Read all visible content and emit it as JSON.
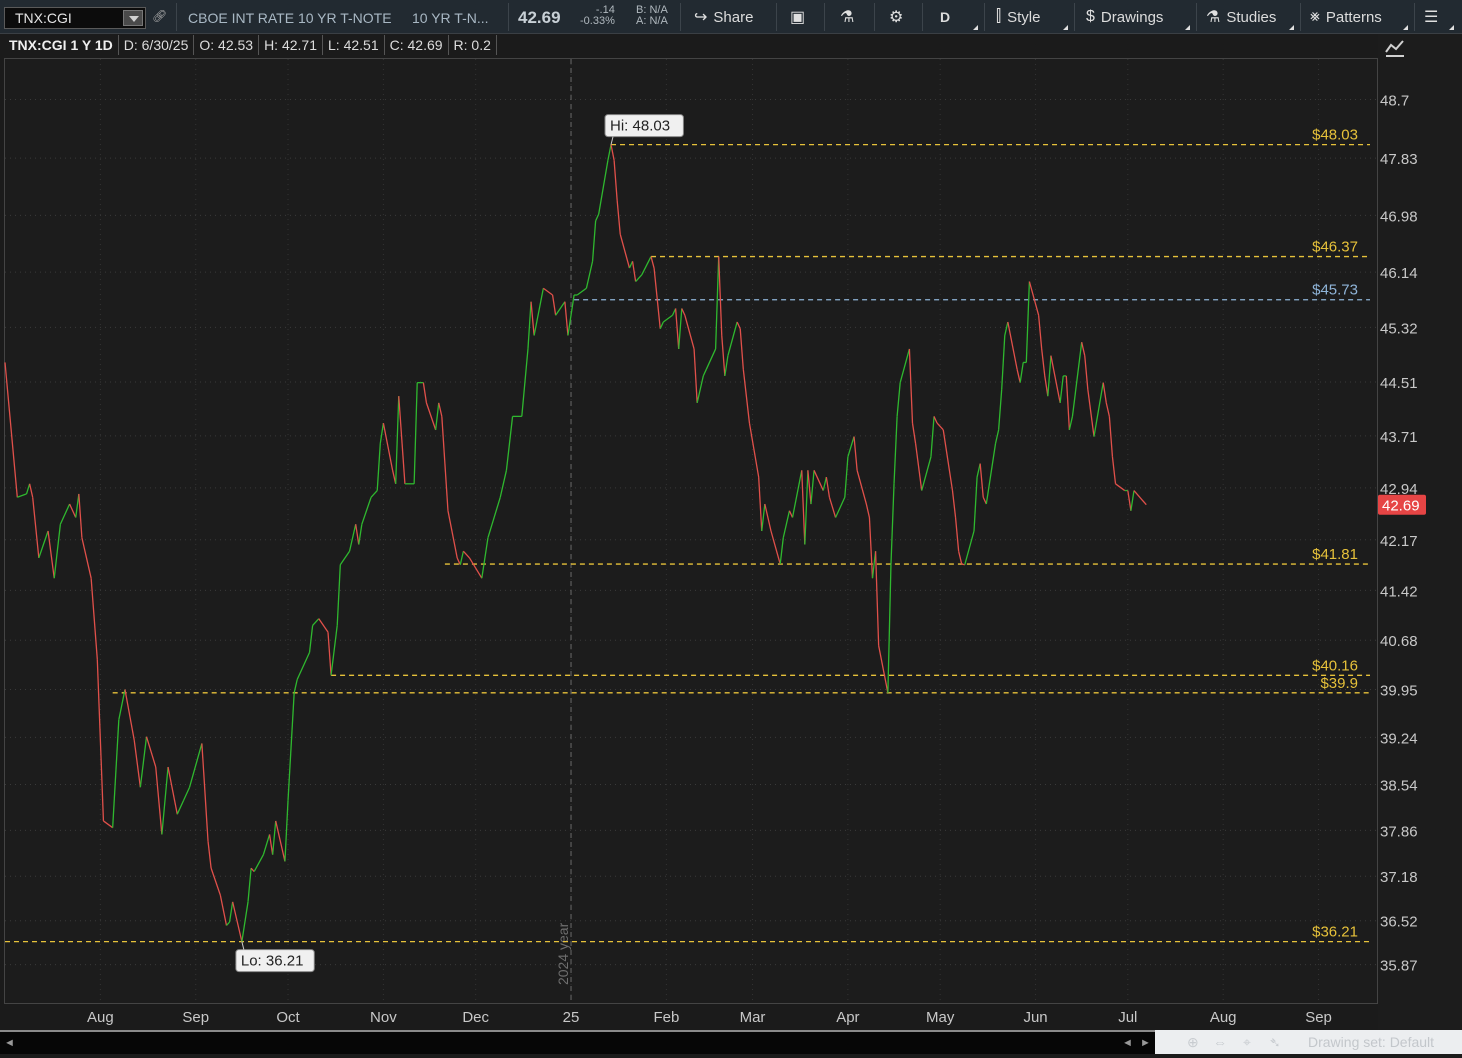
{
  "toolbar": {
    "symbol": "TNX:CGI",
    "description": "CBOE INT RATE 10 YR T-NOTE",
    "short_name": "10 YR T-N...",
    "last": "42.69",
    "change": "-.14",
    "change_pct": "-0.33%",
    "bid": "B: N/A",
    "ask": "A: N/A",
    "share_label": "Share",
    "aggregation": "D",
    "style_label": "Style",
    "drawings_label": "Drawings",
    "studies_label": "Studies",
    "patterns_label": "Patterns"
  },
  "info_bar": {
    "title": "TNX:CGI 1 Y 1D",
    "date": "D: 6/30/25",
    "open": "O: 42.53",
    "high": "H: 42.71",
    "low": "L: 42.51",
    "close": "C: 42.69",
    "range": "R: 0.2"
  },
  "bottom_bar": {
    "drawing_set": "Drawing set: Default"
  },
  "colors": {
    "up": "#2fb82f",
    "down": "#e0504a",
    "level_line": "#e6c13a",
    "level_line_blue": "#8fb4d8",
    "last_price_badge": "#e64545"
  },
  "chart_data": {
    "type": "line",
    "title": "TNX:CGI 1 Y 1D",
    "y_axis_side": "right",
    "ylim": [
      35.3,
      49.3
    ],
    "y_ticks": [
      "48.7",
      "47.83",
      "46.98",
      "46.14",
      "45.32",
      "44.51",
      "43.71",
      "42.94",
      "42.17",
      "41.42",
      "40.68",
      "39.95",
      "39.24",
      "38.54",
      "37.86",
      "37.18",
      "36.52",
      "35.87"
    ],
    "x_ticks": [
      "Aug",
      "Sep",
      "Oct",
      "Nov",
      "Dec",
      "25",
      "Feb",
      "Mar",
      "Apr",
      "May",
      "Jun",
      "Jul",
      "Aug",
      "Sep"
    ],
    "x_range": [
      "2024-07-01",
      "2025-09-20"
    ],
    "year_divider": {
      "date": "2025-01-01",
      "label": "2024 year"
    },
    "last_value": "42.69",
    "high_label": "Hi: 48.03",
    "low_label": "Lo: 36.21",
    "high_point": {
      "date": "2025-01-14",
      "value": 48.03
    },
    "low_point": {
      "date": "2024-09-16",
      "value": 36.21
    },
    "levels": [
      {
        "value": 48.03,
        "label": "$48.03",
        "start": "2025-01-14",
        "color": "yellow"
      },
      {
        "value": 46.37,
        "label": "$46.37",
        "start": "2025-01-27",
        "color": "yellow"
      },
      {
        "value": 45.73,
        "label": "$45.73",
        "start": "2025-01-02",
        "color": "blue"
      },
      {
        "value": 41.81,
        "label": "$41.81",
        "start": "2024-11-21",
        "color": "yellow"
      },
      {
        "value": 40.16,
        "label": "$40.16",
        "start": "2024-10-15",
        "color": "yellow"
      },
      {
        "value": 39.9,
        "label": "$39.9",
        "start": "2024-08-05",
        "color": "yellow"
      },
      {
        "value": 36.21,
        "label": "$36.21",
        "start": "2024-07-01",
        "color": "yellow"
      }
    ],
    "series": [
      {
        "points": [
          [
            "2024-07-01",
            44.8
          ],
          [
            "2024-07-05",
            42.8
          ],
          [
            "2024-07-08",
            42.85
          ],
          [
            "2024-07-09",
            43.0
          ],
          [
            "2024-07-10",
            42.8
          ],
          [
            "2024-07-12",
            41.9
          ],
          [
            "2024-07-15",
            42.3
          ],
          [
            "2024-07-17",
            41.6
          ],
          [
            "2024-07-19",
            42.4
          ],
          [
            "2024-07-22",
            42.7
          ],
          [
            "2024-07-24",
            42.5
          ],
          [
            "2024-07-25",
            42.85
          ],
          [
            "2024-07-26",
            42.2
          ],
          [
            "2024-07-29",
            41.6
          ],
          [
            "2024-07-31",
            40.4
          ],
          [
            "2024-08-02",
            38.0
          ],
          [
            "2024-08-05",
            37.9
          ],
          [
            "2024-08-07",
            39.5
          ],
          [
            "2024-08-09",
            39.95
          ],
          [
            "2024-08-12",
            39.2
          ],
          [
            "2024-08-14",
            38.5
          ],
          [
            "2024-08-16",
            39.25
          ],
          [
            "2024-08-19",
            38.8
          ],
          [
            "2024-08-21",
            37.8
          ],
          [
            "2024-08-23",
            38.8
          ],
          [
            "2024-08-26",
            38.1
          ],
          [
            "2024-08-28",
            38.3
          ],
          [
            "2024-08-30",
            38.5
          ],
          [
            "2024-09-03",
            39.15
          ],
          [
            "2024-09-05",
            37.7
          ],
          [
            "2024-09-06",
            37.3
          ],
          [
            "2024-09-09",
            36.9
          ],
          [
            "2024-09-11",
            36.45
          ],
          [
            "2024-09-12",
            36.5
          ],
          [
            "2024-09-13",
            36.8
          ],
          [
            "2024-09-16",
            36.21
          ],
          [
            "2024-09-18",
            36.8
          ],
          [
            "2024-09-19",
            37.3
          ],
          [
            "2024-09-20",
            37.25
          ],
          [
            "2024-09-23",
            37.5
          ],
          [
            "2024-09-25",
            37.8
          ],
          [
            "2024-09-26",
            37.5
          ],
          [
            "2024-09-27",
            38.0
          ],
          [
            "2024-09-30",
            37.4
          ],
          [
            "2024-10-01",
            38.3
          ],
          [
            "2024-10-03",
            39.9
          ],
          [
            "2024-10-04",
            40.1
          ],
          [
            "2024-10-08",
            40.5
          ],
          [
            "2024-10-09",
            40.9
          ],
          [
            "2024-10-11",
            41.0
          ],
          [
            "2024-10-14",
            40.8
          ],
          [
            "2024-10-15",
            40.16
          ],
          [
            "2024-10-17",
            40.9
          ],
          [
            "2024-10-18",
            41.8
          ],
          [
            "2024-10-21",
            42.0
          ],
          [
            "2024-10-23",
            42.4
          ],
          [
            "2024-10-24",
            42.1
          ],
          [
            "2024-10-25",
            42.4
          ],
          [
            "2024-10-28",
            42.8
          ],
          [
            "2024-10-30",
            42.9
          ],
          [
            "2024-10-31",
            43.6
          ],
          [
            "2024-11-01",
            43.9
          ],
          [
            "2024-11-04",
            43.2
          ],
          [
            "2024-11-05",
            43.0
          ],
          [
            "2024-11-06",
            44.3
          ],
          [
            "2024-11-08",
            43.0
          ],
          [
            "2024-11-11",
            43.0
          ],
          [
            "2024-11-12",
            44.5
          ],
          [
            "2024-11-14",
            44.5
          ],
          [
            "2024-11-15",
            44.2
          ],
          [
            "2024-11-18",
            43.8
          ],
          [
            "2024-11-19",
            44.2
          ],
          [
            "2024-11-20",
            44.0
          ],
          [
            "2024-11-22",
            42.6
          ],
          [
            "2024-11-25",
            41.9
          ],
          [
            "2024-11-26",
            41.8
          ],
          [
            "2024-11-27",
            42.0
          ],
          [
            "2024-11-29",
            41.9
          ],
          [
            "2024-12-03",
            41.6
          ],
          [
            "2024-12-05",
            42.2
          ],
          [
            "2024-12-09",
            42.8
          ],
          [
            "2024-12-11",
            43.2
          ],
          [
            "2024-12-13",
            44.0
          ],
          [
            "2024-12-16",
            44.0
          ],
          [
            "2024-12-18",
            45.0
          ],
          [
            "2024-12-19",
            45.7
          ],
          [
            "2024-12-20",
            45.2
          ],
          [
            "2024-12-23",
            45.9
          ],
          [
            "2024-12-26",
            45.8
          ],
          [
            "2024-12-27",
            45.5
          ],
          [
            "2024-12-30",
            45.7
          ],
          [
            "2024-12-31",
            45.2
          ],
          [
            "2025-01-02",
            45.8
          ],
          [
            "2025-01-03",
            45.8
          ],
          [
            "2025-01-06",
            45.9
          ],
          [
            "2025-01-08",
            46.3
          ],
          [
            "2025-01-09",
            46.9
          ],
          [
            "2025-01-10",
            47.0
          ],
          [
            "2025-01-13",
            47.8
          ],
          [
            "2025-01-14",
            48.03
          ],
          [
            "2025-01-15",
            47.8
          ],
          [
            "2025-01-16",
            47.2
          ],
          [
            "2025-01-17",
            46.7
          ],
          [
            "2025-01-20",
            46.2
          ],
          [
            "2025-01-21",
            46.3
          ],
          [
            "2025-01-22",
            46.0
          ],
          [
            "2025-01-24",
            46.1
          ],
          [
            "2025-01-27",
            46.37
          ],
          [
            "2025-01-28",
            46.2
          ],
          [
            "2025-01-30",
            45.3
          ],
          [
            "2025-01-31",
            45.4
          ],
          [
            "2025-02-03",
            45.5
          ],
          [
            "2025-02-04",
            45.6
          ],
          [
            "2025-02-05",
            45.0
          ],
          [
            "2025-02-06",
            45.6
          ],
          [
            "2025-02-07",
            45.5
          ],
          [
            "2025-02-10",
            45.0
          ],
          [
            "2025-02-11",
            44.2
          ],
          [
            "2025-02-13",
            44.6
          ],
          [
            "2025-02-14",
            44.7
          ],
          [
            "2025-02-17",
            45.0
          ],
          [
            "2025-02-18",
            46.37
          ],
          [
            "2025-02-19",
            45.2
          ],
          [
            "2025-02-20",
            44.6
          ],
          [
            "2025-02-21",
            44.9
          ],
          [
            "2025-02-24",
            45.4
          ],
          [
            "2025-02-25",
            45.3
          ],
          [
            "2025-02-26",
            44.7
          ],
          [
            "2025-02-28",
            43.9
          ],
          [
            "2025-03-03",
            43.1
          ],
          [
            "2025-03-04",
            42.3
          ],
          [
            "2025-03-05",
            42.7
          ],
          [
            "2025-03-07",
            42.3
          ],
          [
            "2025-03-10",
            41.81
          ],
          [
            "2025-03-11",
            42.2
          ],
          [
            "2025-03-13",
            42.6
          ],
          [
            "2025-03-14",
            42.5
          ],
          [
            "2025-03-17",
            43.2
          ],
          [
            "2025-03-18",
            42.1
          ],
          [
            "2025-03-19",
            43.2
          ],
          [
            "2025-03-20",
            42.7
          ],
          [
            "2025-03-21",
            43.2
          ],
          [
            "2025-03-24",
            42.9
          ],
          [
            "2025-03-25",
            43.1
          ],
          [
            "2025-03-26",
            42.8
          ],
          [
            "2025-03-28",
            42.5
          ],
          [
            "2025-03-31",
            42.8
          ],
          [
            "2025-04-01",
            43.4
          ],
          [
            "2025-04-03",
            43.7
          ],
          [
            "2025-04-04",
            43.2
          ],
          [
            "2025-04-07",
            42.7
          ],
          [
            "2025-04-08",
            42.5
          ],
          [
            "2025-04-09",
            41.6
          ],
          [
            "2025-04-10",
            42.0
          ],
          [
            "2025-04-11",
            40.6
          ],
          [
            "2025-04-14",
            39.9
          ],
          [
            "2025-04-15",
            41.8
          ],
          [
            "2025-04-16",
            43.0
          ],
          [
            "2025-04-17",
            44.0
          ],
          [
            "2025-04-18",
            44.5
          ],
          [
            "2025-04-21",
            45.0
          ],
          [
            "2025-04-22",
            43.9
          ],
          [
            "2025-04-23",
            43.6
          ],
          [
            "2025-04-25",
            42.9
          ],
          [
            "2025-04-28",
            43.4
          ],
          [
            "2025-04-29",
            44.0
          ],
          [
            "2025-04-30",
            43.9
          ],
          [
            "2025-05-02",
            43.8
          ],
          [
            "2025-05-05",
            42.9
          ],
          [
            "2025-05-06",
            42.5
          ],
          [
            "2025-05-07",
            42.0
          ],
          [
            "2025-05-08",
            41.81
          ],
          [
            "2025-05-09",
            41.8
          ],
          [
            "2025-05-12",
            42.3
          ],
          [
            "2025-05-13",
            43.1
          ],
          [
            "2025-05-14",
            43.3
          ],
          [
            "2025-05-15",
            42.8
          ],
          [
            "2025-05-16",
            42.7
          ],
          [
            "2025-05-19",
            43.6
          ],
          [
            "2025-05-20",
            43.8
          ],
          [
            "2025-05-21",
            44.4
          ],
          [
            "2025-05-22",
            45.2
          ],
          [
            "2025-05-23",
            45.4
          ],
          [
            "2025-05-26",
            44.7
          ],
          [
            "2025-05-27",
            44.5
          ],
          [
            "2025-05-28",
            44.8
          ],
          [
            "2025-05-29",
            44.8
          ],
          [
            "2025-05-30",
            46.0
          ],
          [
            "2025-06-02",
            45.5
          ],
          [
            "2025-06-03",
            45.0
          ],
          [
            "2025-06-04",
            44.6
          ],
          [
            "2025-06-05",
            44.3
          ],
          [
            "2025-06-06",
            44.9
          ],
          [
            "2025-06-09",
            44.2
          ],
          [
            "2025-06-10",
            44.6
          ],
          [
            "2025-06-11",
            44.6
          ],
          [
            "2025-06-12",
            43.8
          ],
          [
            "2025-06-13",
            44.0
          ],
          [
            "2025-06-16",
            45.1
          ],
          [
            "2025-06-17",
            44.9
          ],
          [
            "2025-06-18",
            44.4
          ],
          [
            "2025-06-20",
            43.7
          ],
          [
            "2025-06-23",
            44.5
          ],
          [
            "2025-06-24",
            44.2
          ],
          [
            "2025-06-25",
            44.0
          ],
          [
            "2025-06-26",
            43.4
          ],
          [
            "2025-06-27",
            43.0
          ],
          [
            "2025-06-30",
            42.9
          ],
          [
            "2025-07-01",
            42.9
          ],
          [
            "2025-07-02",
            42.6
          ],
          [
            "2025-07-03",
            42.9
          ],
          [
            "2025-07-07",
            42.69
          ]
        ]
      }
    ]
  }
}
